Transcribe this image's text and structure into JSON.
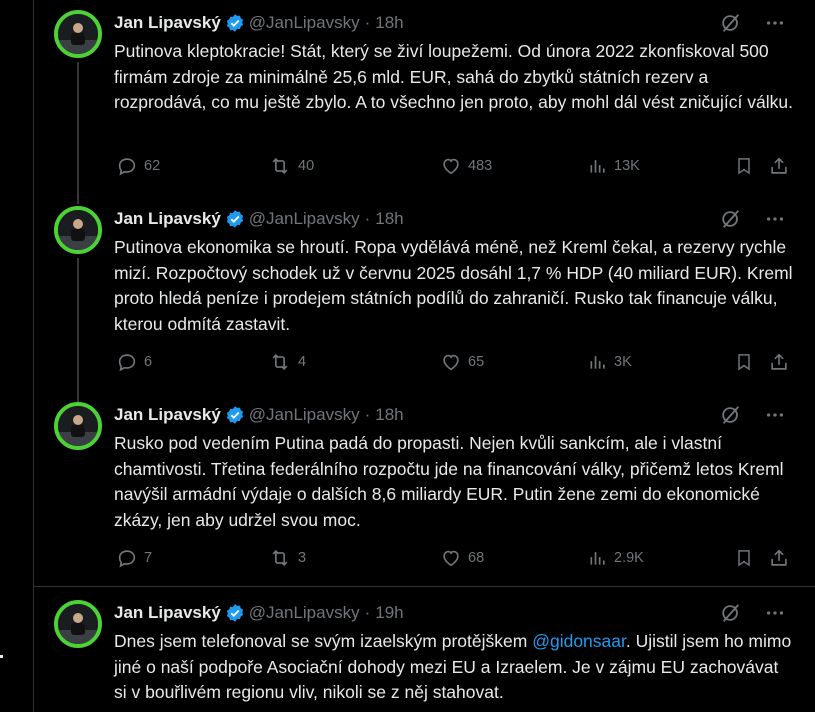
{
  "tweets": [
    {
      "author": "Jan Lipavský",
      "handle": "@JanLipavsky",
      "separator": "·",
      "time": "18h",
      "text": "Putinova kleptokracie! Stát, který se živí loupežemi. Od února 2022 zkonfiskoval 500 firmám zdroje za minimálně 25,6 mld. EUR, sahá do zbytků státních rezerv a rozprodává, co mu ještě zbylo. A to všechno jen proto, aby mohl dál vést zničující válku.",
      "replies": "62",
      "reposts": "40",
      "likes": "483",
      "views": "13K"
    },
    {
      "author": "Jan Lipavský",
      "handle": "@JanLipavsky",
      "separator": "·",
      "time": "18h",
      "text": "Putinova ekonomika se hroutí. Ropa vydělává méně, než Kreml čekal, a rezervy rychle mizí. Rozpočtový schodek už v červnu 2025 dosáhl 1,7 % HDP (40 miliard EUR). Kreml proto hledá peníze i prodejem státních podílů do zahraničí. Rusko tak financuje válku, kterou odmítá zastavit.",
      "replies": "6",
      "reposts": "4",
      "likes": "65",
      "views": "3K"
    },
    {
      "author": "Jan Lipavský",
      "handle": "@JanLipavsky",
      "separator": "·",
      "time": "18h",
      "text": "Rusko pod vedením Putina padá do propasti. Nejen kvůli sankcím, ale i vlastní chamtivosti. Třetina federálního rozpočtu jde na financování války, přičemž letos Kreml navýšil armádní výdaje o dalších 8,6 miliardy EUR. Putin žene zemi do ekonomické zkázy, jen aby udržel svou moc.",
      "replies": "7",
      "reposts": "3",
      "likes": "68",
      "views": "2.9K"
    },
    {
      "author": "Jan Lipavský",
      "handle": "@JanLipavsky",
      "separator": "·",
      "time": "19h",
      "text_before": "Dnes jsem telefonoval se svým izaelským protějškem ",
      "mention": "@gidonsaar",
      "text_after": ". Ujistil jsem ho mimo jiné o naší podpoře Asociační dohody mezi EU a Izraelem. Je v zájmu EU zachovávat si v bouřlivém regionu vliv, nikoli se z něj stahovat."
    }
  ],
  "icons": {
    "verified": "verified-badge-icon",
    "grok": "grok-icon",
    "more": "more-icon",
    "reply": "reply-icon",
    "repost": "repost-icon",
    "like": "like-icon",
    "views": "views-icon",
    "bookmark": "bookmark-icon",
    "share": "share-icon"
  },
  "colors": {
    "background": "#000000",
    "text": "#e7e9ea",
    "muted": "#71767b",
    "link": "#1d9bf0",
    "verified": "#1d9bf0",
    "avatar_ring": "#4cd137"
  }
}
